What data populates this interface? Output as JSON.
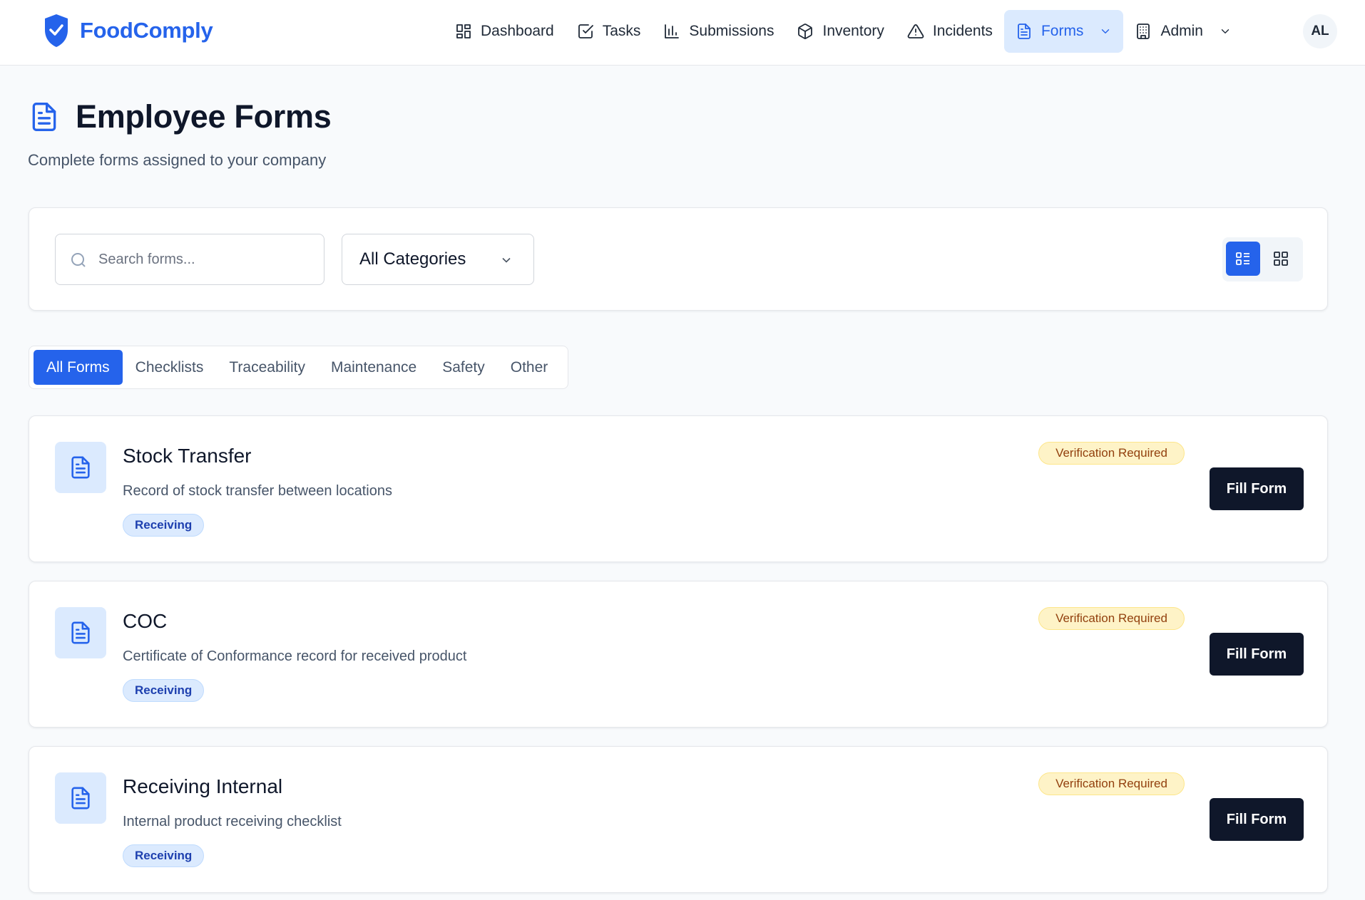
{
  "app": {
    "name": "FoodComply"
  },
  "nav": {
    "items": [
      {
        "label": "Dashboard",
        "icon": "dashboard-icon"
      },
      {
        "label": "Tasks",
        "icon": "check-square-icon"
      },
      {
        "label": "Submissions",
        "icon": "bar-chart-icon"
      },
      {
        "label": "Inventory",
        "icon": "package-icon"
      },
      {
        "label": "Incidents",
        "icon": "warning-icon"
      },
      {
        "label": "Forms",
        "icon": "file-text-icon",
        "active": true
      },
      {
        "label": "Admin",
        "icon": "building-icon"
      }
    ],
    "avatar_initials": "AL"
  },
  "page": {
    "title": "Employee Forms",
    "subtitle": "Complete forms assigned to your company"
  },
  "filters": {
    "search_placeholder": "Search forms...",
    "category_selected": "All Categories",
    "view_mode": "list"
  },
  "tabs": [
    {
      "label": "All Forms",
      "active": true
    },
    {
      "label": "Checklists"
    },
    {
      "label": "Traceability"
    },
    {
      "label": "Maintenance"
    },
    {
      "label": "Safety"
    },
    {
      "label": "Other"
    }
  ],
  "forms": [
    {
      "title": "Stock Transfer",
      "description": "Record of stock transfer between locations",
      "tag": "Receiving",
      "badge": "Verification Required",
      "action": "Fill Form"
    },
    {
      "title": "COC",
      "description": "Certificate of Conformance record for received product",
      "tag": "Receiving",
      "badge": "Verification Required",
      "action": "Fill Form"
    },
    {
      "title": "Receiving Internal",
      "description": "Internal product receiving checklist",
      "tag": "Receiving",
      "badge": "Verification Required",
      "action": "Fill Form"
    }
  ],
  "colors": {
    "brand": "#2563eb",
    "nav_active_bg": "#dbeafe",
    "badge_warning_bg": "#fef3c7",
    "badge_warning_text": "#92400e",
    "button_dark": "#0f172a"
  }
}
